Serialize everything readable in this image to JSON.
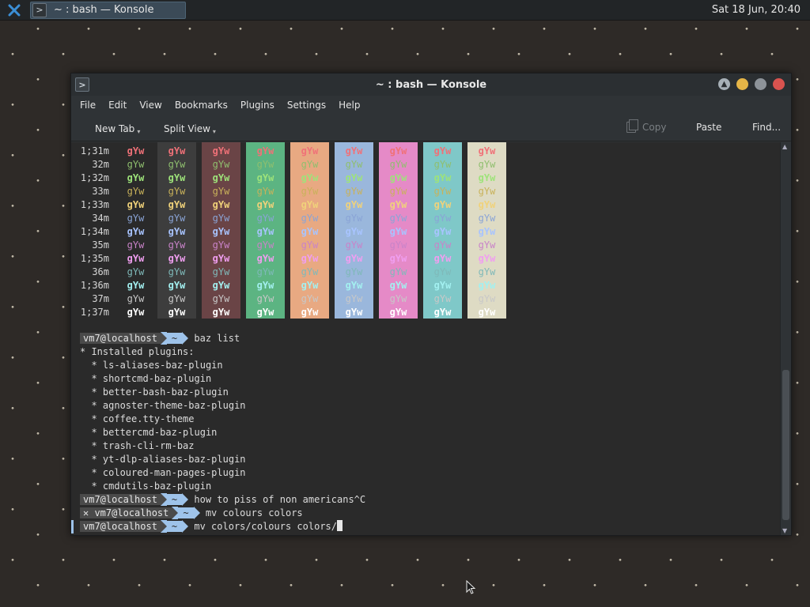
{
  "panel": {
    "task_label": "~ : bash — Konsole",
    "clock": "Sat 18 Jun, 20:40"
  },
  "window": {
    "title": "~ : bash — Konsole",
    "menu": [
      "File",
      "Edit",
      "View",
      "Bookmarks",
      "Plugins",
      "Settings",
      "Help"
    ],
    "toolbar": {
      "new_tab": "New Tab",
      "split_view": "Split View",
      "copy": "Copy",
      "paste": "Paste",
      "find": "Find..."
    }
  },
  "terminal": {
    "color_table": {
      "sample": "gYw",
      "row_labels": [
        "1;31m",
        "32m",
        "1;32m",
        "33m",
        "1;33m",
        "34m",
        "1;34m",
        "35m",
        "1;35m",
        "36m",
        "1;36m",
        "37m",
        "1;37m"
      ],
      "fg_colors": [
        "#f07178",
        "#8fbf6e",
        "#9ee37a",
        "#c9b25a",
        "#f0d27a",
        "#8aa4d6",
        "#a8c4ff",
        "#c983c9",
        "#f09ef0",
        "#7fb9b9",
        "#a3f0f0",
        "#c8c8c8",
        "#ffffff"
      ],
      "bg_colors": [
        "#2a2a2a",
        "#3d3d3d",
        "#6a4446",
        "#5cb482",
        "#e8a982",
        "#9ab7dc",
        "#e58ac7",
        "#7fc8c8",
        "#dedbc4"
      ]
    },
    "prompt": {
      "host": "vm7@localhost",
      "dir": "~"
    },
    "lines": [
      {
        "type": "prompt",
        "cmd": "baz list"
      },
      {
        "type": "out",
        "text": "* Installed plugins:"
      },
      {
        "type": "out",
        "text": "  * ls-aliases-baz-plugin"
      },
      {
        "type": "out",
        "text": "  * shortcmd-baz-plugin"
      },
      {
        "type": "out",
        "text": "  * better-bash-baz-plugin"
      },
      {
        "type": "out",
        "text": "  * agnoster-theme-baz-plugin"
      },
      {
        "type": "out",
        "text": "  * coffee.tty-theme"
      },
      {
        "type": "out",
        "text": "  * bettercmd-baz-plugin"
      },
      {
        "type": "out",
        "text": "  * trash-cli-rm-baz"
      },
      {
        "type": "out",
        "text": "  * yt-dlp-aliases-baz-plugin"
      },
      {
        "type": "out",
        "text": "  * coloured-man-pages-plugin"
      },
      {
        "type": "out",
        "text": "  * cmdutils-baz-plugin"
      },
      {
        "type": "prompt",
        "cmd": "how to piss of non americans^C"
      },
      {
        "type": "prompt-error",
        "mark": "✕",
        "cmd": "mv colours colors"
      },
      {
        "type": "prompt-current",
        "cmd": "mv colors/colours colors/"
      }
    ]
  }
}
